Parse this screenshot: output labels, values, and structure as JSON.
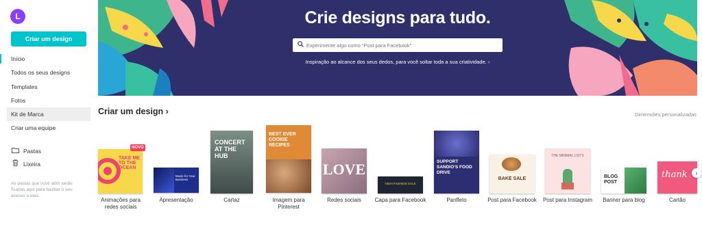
{
  "sidebar": {
    "avatar_letter": "L",
    "create_button": "Criar um design",
    "nav": [
      "Início",
      "Todos os seus designs",
      "Templates",
      "Fotos",
      "Kit de Marca",
      "Criar uma equipe"
    ],
    "folders": "Pastas",
    "trash": "Lixeira",
    "note": "As pastas que você abrir serão fixadas aqui para facilitar o seu acesso a elas."
  },
  "hero": {
    "title": "Crie designs para tudo.",
    "search_placeholder": "Experimente algo como \"Post para Facebook\"",
    "subtitle": "Inspiração ao alcance dos seus dedos, para você soltar toda a sua criatividade. ›"
  },
  "section": {
    "title": "Criar um design ›",
    "custom_dims": "Dimensões personalizadas",
    "new_badge": "NOVO"
  },
  "cards": [
    {
      "label": "Animações para redes sociais",
      "thumb_text": "TAKE ME TO THE OCEAN"
    },
    {
      "label": "Apresentação",
      "thumb_text": "Music for Your Business"
    },
    {
      "label": "Cartaz",
      "thumb_text": "CONCERT AT THE HUB"
    },
    {
      "label": "Imagem para Pinterest",
      "thumb_text": "BEST EVER COOKIE RECIPES"
    },
    {
      "label": "Redes sociais",
      "thumb_text": "LOVE"
    },
    {
      "label": "Capa para Facebook",
      "thumb_text": "HIGH FASHION SALE"
    },
    {
      "label": "Panfleto",
      "thumb_text": "SUPPORT SANDIO'S FOOD DRIVE"
    },
    {
      "label": "Post para Facebook",
      "thumb_text": "BAKE SALE"
    },
    {
      "label": "Post para Instagram",
      "thumb_text": "THE MINIMAL LISTS"
    },
    {
      "label": "Banner para blog",
      "thumb_text": "BLOG POST"
    },
    {
      "label": "Cartão",
      "thumb_text": "thank"
    }
  ],
  "colors": {
    "accent": "#00c4cc",
    "hero_bg": "#2e2f6b",
    "avatar": "#8b3dff",
    "badge": "#ff3b5c"
  },
  "icons": {
    "search": "search-icon",
    "folder": "folder-icon",
    "trash": "trash-icon",
    "next": "chevron-right-icon"
  }
}
